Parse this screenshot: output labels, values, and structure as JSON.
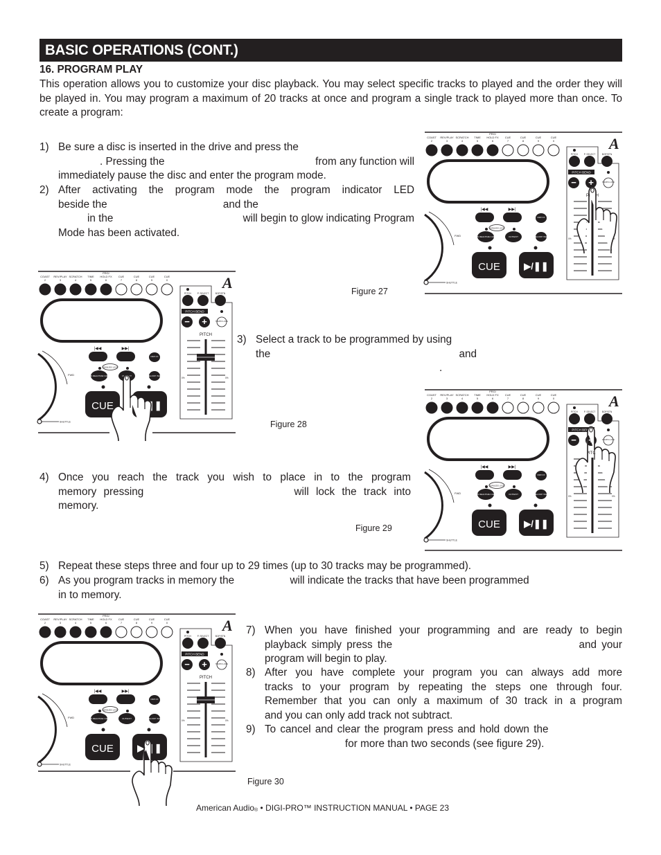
{
  "header": {
    "title": "BASIC OPERATIONS (CONT.)"
  },
  "section": {
    "number": "16",
    "title": "PROGRAM PLAY"
  },
  "intro": "This operation allows you to customize your disc playback. You may select specific tracks to played and the order they will be played in. You may program a maximum of 20 tracks at once and program a single track to played more than once. To create a program:",
  "steps": [
    {
      "num": "1)",
      "lines": [
        "Be sure a disc is inserted in the drive and press the",
        ". Pressing the",
        "from any function will",
        "immediately pause the disc and enter the program mode."
      ]
    },
    {
      "num": "2)",
      "lines": [
        "After activating the program mode the program indicator LED",
        "beside the",
        "and the",
        "in the",
        "will begin to glow indicating Program",
        "Mode has been activated."
      ]
    },
    {
      "num": "3)",
      "lines": [
        "Select a track to be programmed by using",
        "the",
        "and",
        "."
      ]
    },
    {
      "num": "4)",
      "lines": [
        "Once you reach the track you wish to place in to the program",
        "memory pressing",
        "will lock the track into",
        "memory."
      ]
    },
    {
      "num": "5)",
      "lines": [
        "Repeat these steps three and four up to 29 times (up to 30 tracks may be programmed)."
      ]
    },
    {
      "num": "6)",
      "lines": [
        "As you program tracks in memory the",
        "will indicate the tracks that have been programmed",
        "in to memory."
      ]
    },
    {
      "num": "7)",
      "lines": [
        "When you have finished your programming and are ready to begin",
        "playback simply press the",
        "and your",
        "program will begin to play."
      ]
    },
    {
      "num": "8)",
      "lines": [
        "After you have complete your program you can always add more",
        "tracks to your program by repeating the steps one through four.",
        "Remember that you can only a maximum of 30 track in a program",
        "and you can only add track not subtract."
      ]
    },
    {
      "num": "9)",
      "lines": [
        "To cancel and clear the program press and hold down the",
        "for more than two seconds (see figure 29)."
      ]
    }
  ],
  "figures": [
    {
      "id": "27",
      "caption": "Figure 27",
      "hand_on": "pitch-fader"
    },
    {
      "id": "28",
      "caption": "Figure 28",
      "hand_on": "out-exit-button"
    },
    {
      "id": "29",
      "caption": "Figure 29",
      "hand_on": "pitch-bend-plus"
    },
    {
      "id": "30",
      "caption": "Figure 30",
      "hand_on": "play-pause-button"
    }
  ],
  "player": {
    "top_buttons": [
      {
        "label": "COAST",
        "num": "2",
        "filled": true
      },
      {
        "label": "REV/PLAY",
        "num": "3",
        "filled": true
      },
      {
        "label": "SCRATCH",
        "num": "4",
        "filled": true
      },
      {
        "label": "TIME",
        "num": "5",
        "filled": true
      },
      {
        "label": "PRG/ HOLD FX",
        "num": "6",
        "filled": true
      },
      {
        "label": "CUE",
        "num": "7",
        "filled": false
      },
      {
        "label": "CUE",
        "num": "8",
        "filled": false
      },
      {
        "label": "CUE",
        "num": "9",
        "filled": false
      },
      {
        "label": "CUE",
        "num": "0",
        "filled": false
      }
    ],
    "skip_back": "|◀◀",
    "skip_fwd": "▶▶|",
    "dim_fx": "DIM/ FX",
    "seamless_loop": "SEAMLESS LOOP",
    "in_button": "IN REALTIME CUE",
    "out_button": "OUT/EXIT",
    "reloop_button": "RELOOP /SGP",
    "cue_label": "CUE",
    "play_label": "▶/❚❚",
    "fwd_label": "FWD",
    "shuttle_label": "SHUTTLE",
    "pitch_button": "PITCH",
    "p_select_button": "P. SELECT",
    "bop_button": "BOP/STN",
    "pitch_bend_label": "PITCH BEND",
    "minus": "−",
    "plus": "+",
    "tempo_lock": "TEMPO LOCK",
    "pitch_label": "PITCH",
    "zero_pct": "0%",
    "logo": "A"
  },
  "footer": {
    "brand": "American Audio",
    "reg": "®",
    "rest": " • DIGI-PRO™ INSTRUCTION MANUAL • PAGE 23"
  }
}
